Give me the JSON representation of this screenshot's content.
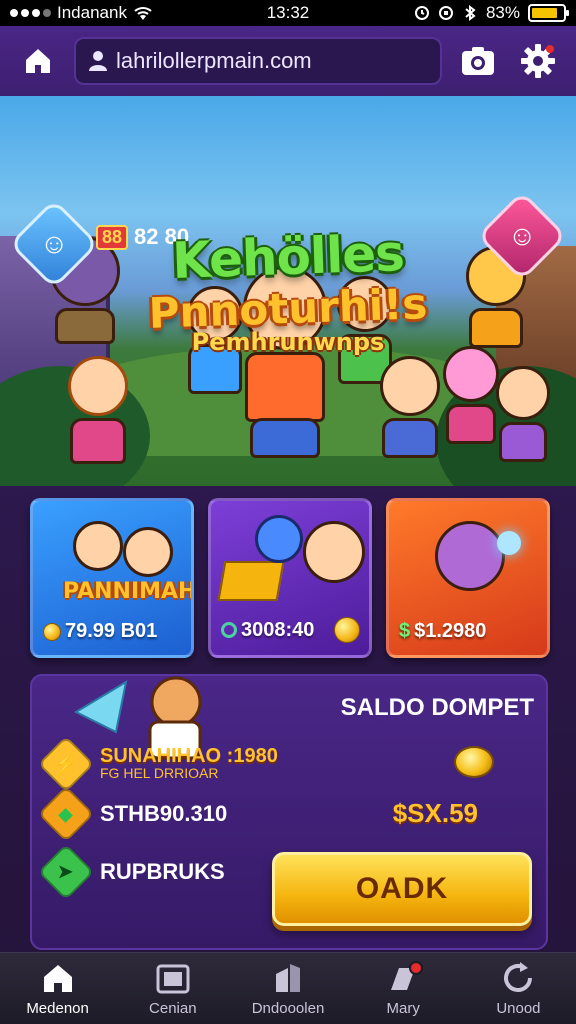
{
  "status_bar": {
    "carrier": "Indanank",
    "time": "13:32",
    "battery_percent": "83%",
    "battery_level": 0.83
  },
  "top_nav": {
    "url": "lahrilollerpmain.com"
  },
  "hero": {
    "score": "82 80",
    "score_badge": "88",
    "title_line1": "Kehölles",
    "title_line2": "Pnnoturhi!s",
    "title_line3": "Pemhrunwnps"
  },
  "cards": [
    {
      "art_title": "PANNIMAHS",
      "price": "79.99 B01"
    },
    {
      "art_title": "",
      "price": "3008:40"
    },
    {
      "art_title": "",
      "price": "$1.2980"
    }
  ],
  "wallet": {
    "title": "SALDO DOMPET",
    "promo_line1": "SUNAHIHAO :1980",
    "promo_line2": "FG HEL DRRIOAR",
    "stat_value": "STHB90.310",
    "rewards_label": "RUPBRUKS",
    "balance": "$SX.59",
    "action_button": "OADK"
  },
  "bottom_nav": [
    {
      "label": "Medenon",
      "icon": "home-icon",
      "active": true
    },
    {
      "label": "Cenian",
      "icon": "camera-icon",
      "active": false
    },
    {
      "label": "Dndooolen",
      "icon": "building-icon",
      "active": false
    },
    {
      "label": "Mary",
      "icon": "tag-icon",
      "active": false,
      "notification": true
    },
    {
      "label": "Unood",
      "icon": "refresh-icon",
      "active": false
    }
  ],
  "colors": {
    "brand_purple": "#3d1f70",
    "accent_gold": "#ffc22d",
    "logo_green": "#6ee34a"
  }
}
